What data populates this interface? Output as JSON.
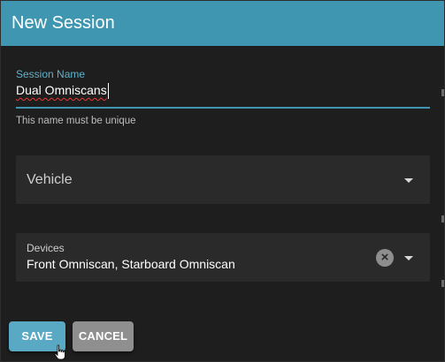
{
  "dialog": {
    "title": "New Session"
  },
  "session_name": {
    "label": "Session Name",
    "value": "Dual Omniscans",
    "hint": "This name must be unique"
  },
  "vehicle": {
    "placeholder": "Vehicle"
  },
  "devices": {
    "label": "Devices",
    "value": "Front Omniscan, Starboard Omniscan"
  },
  "buttons": {
    "save_label": "SAVE",
    "cancel_label": "CANCEL"
  },
  "colors": {
    "accent": "#3f96b0",
    "background": "#1e1e1e",
    "field_background": "#2a2a2a",
    "spellcheck": "#e53935"
  },
  "icons": {
    "clear": "close-circle-icon",
    "dropdown": "chevron-down-icon",
    "cursor": "hand-pointer-icon"
  }
}
